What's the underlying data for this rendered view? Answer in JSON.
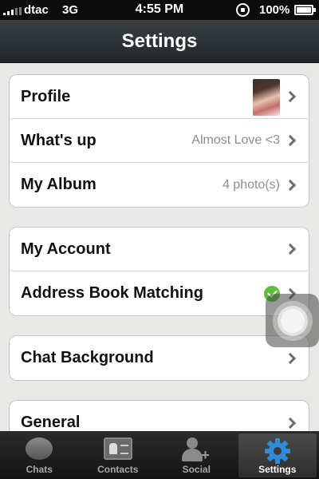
{
  "status_bar": {
    "carrier": "dtac",
    "network": "3G",
    "time": "4:55 PM",
    "battery": "100%"
  },
  "header": {
    "title": "Settings"
  },
  "groups": [
    {
      "rows": [
        {
          "label": "Profile",
          "value": ""
        },
        {
          "label": "What's up",
          "value": "Almost Love <3"
        },
        {
          "label": "My Album",
          "value": "4 photo(s)"
        }
      ]
    },
    {
      "rows": [
        {
          "label": "My Account",
          "value": ""
        },
        {
          "label": "Address Book Matching",
          "value": ""
        }
      ]
    },
    {
      "rows": [
        {
          "label": "Chat Background",
          "value": ""
        }
      ]
    },
    {
      "rows": [
        {
          "label": "General",
          "value": ""
        }
      ]
    }
  ],
  "tabs": [
    {
      "label": "Chats",
      "icon": "chat-bubble-icon"
    },
    {
      "label": "Contacts",
      "icon": "contacts-card-icon"
    },
    {
      "label": "Social",
      "icon": "add-person-icon"
    },
    {
      "label": "Settings",
      "icon": "gear-icon",
      "selected": true
    }
  ],
  "colors": {
    "accent_check": "#5cbf3b",
    "gear_blue": "#2f8ad8",
    "header_bg": "#2b3034"
  }
}
